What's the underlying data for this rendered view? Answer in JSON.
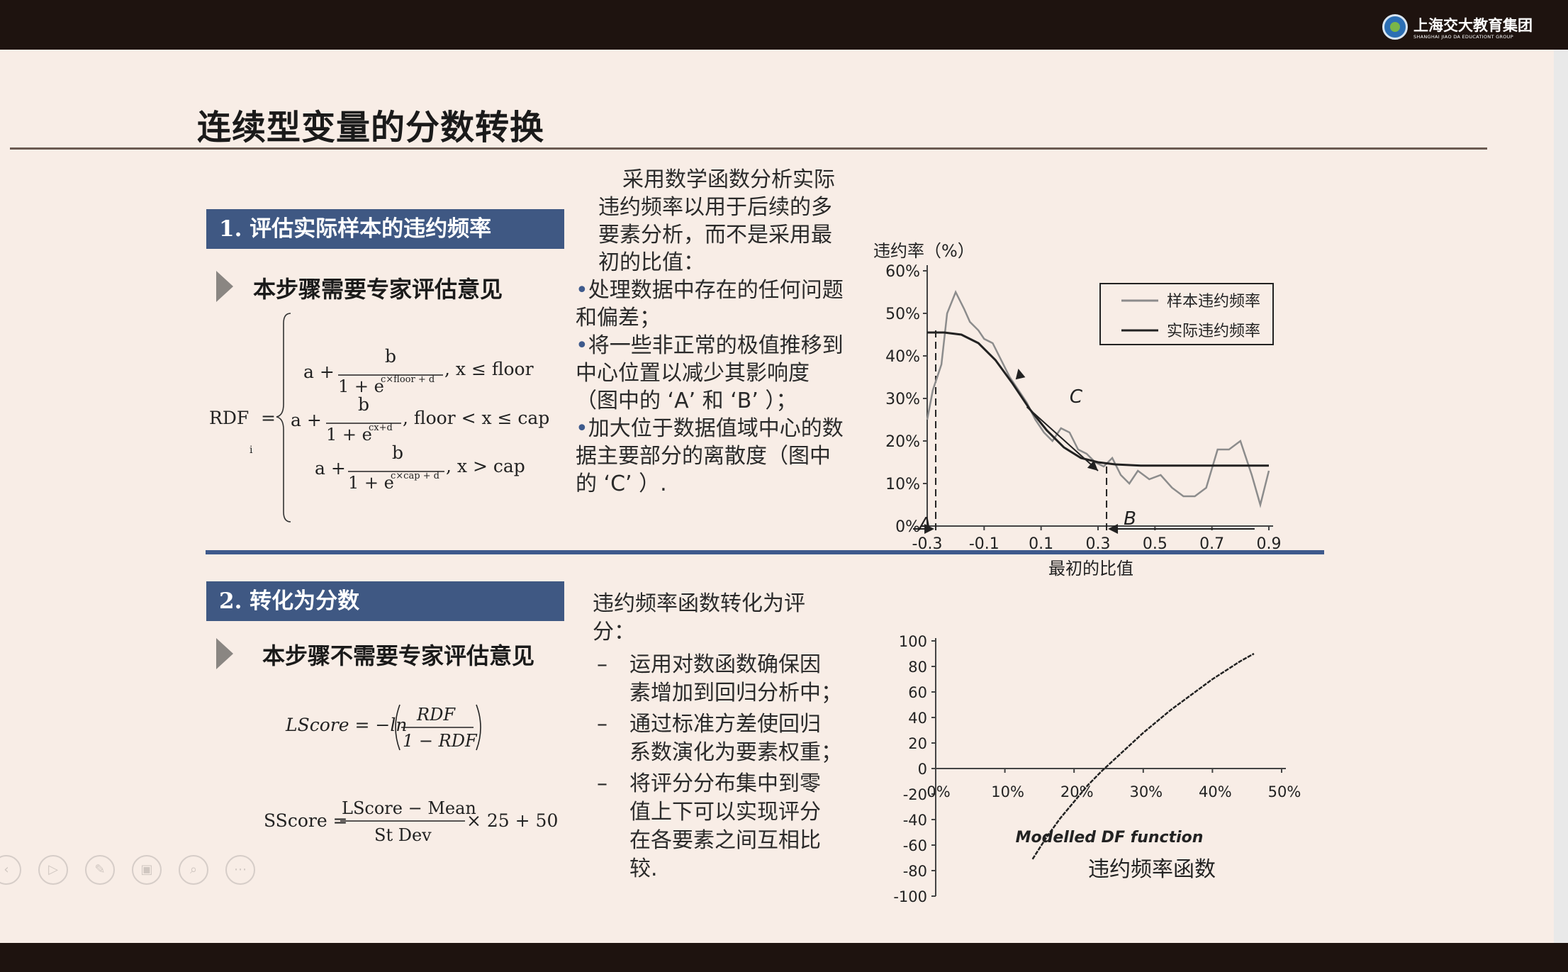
{
  "header": {
    "logo_text": "上海交大教育集团",
    "logo_subtext": "SHANGHAI JIAO DA EDUCATIONT GROUP"
  },
  "slide": {
    "title": "连续型变量的分数转换"
  },
  "step1": {
    "banner": "1.  评估实际样本的违约频率",
    "note": "本步骤需要专家评估意见",
    "text": {
      "intro_line1": "采用数学函数分析实际",
      "intro_line2": "违约频率以用于后续的多",
      "intro_line3": "要素分析，而不是采用最",
      "intro_line4": "初的比值：",
      "b1_line1": "处理数据中存在的任何问题",
      "b1_line2": "和偏差；",
      "b2_line1": "将一些非正常的极值推移到",
      "b2_line2": "中心位置以减少其影响度",
      "b2_line3": "（图中的 ‘A’  和  ‘B’  ）；",
      "b3_line1": "加大位于数据值域中心的数",
      "b3_line2": "据主要部分的离散度（图中",
      "b3_line3": "的 ‘C’  ）."
    },
    "formula": {
      "lhs": "RDF",
      "sub": "i",
      "eq": "=",
      "r1_a": "a +",
      "r1_num": "b",
      "r1_den": "1 + e",
      "r1_exp": "c×floor + d",
      "r1_cond": ", x ≤ floor",
      "r2_a": "a +",
      "r2_num": "b",
      "r2_den": "1 + e",
      "r2_exp": "cx+d",
      "r2_cond": ", floor  < x ≤ cap",
      "r3_a": "a +",
      "r3_num": "b",
      "r3_den": "1 + e",
      "r3_exp": "c×cap + d",
      "r3_cond": ", x > cap"
    }
  },
  "step2": {
    "banner": "2.  转化为分数",
    "note": "本步骤不需要专家评估意见",
    "text": {
      "intro_line1": "违约频率函数转化为评",
      "intro_line2": "分：",
      "d1_line1": "运用对数函数确保因",
      "d1_line2": "素增加到回归分析中；",
      "d2_line1": "通过标准方差使回归",
      "d2_line2": "系数演化为要素权重；",
      "d3_line1": "将评分分布集中到零",
      "d3_line2": "值上下可以实现评分",
      "d3_line3": "在各要素之间互相比",
      "d3_line4": "较.",
      "dash": "–"
    },
    "formula": {
      "lscore_lhs": "LScore = −ln",
      "lscore_num": "RDF",
      "lscore_den": "1 − RDF",
      "sscore_lhs": "SScore =",
      "sscore_num": "LScore − Mean",
      "sscore_den": "St Dev",
      "sscore_tail": "× 25 + 50"
    }
  },
  "chart_data": [
    {
      "type": "line",
      "ylabel": "违约率（%）",
      "xlabel": "最初的比值",
      "x_ticks": [
        "-0.3",
        "-0.1",
        "0.1",
        "0.3",
        "0.5",
        "0.7",
        "0.9"
      ],
      "y_ticks": [
        "0%",
        "10%",
        "20%",
        "30%",
        "40%",
        "50%",
        "60%"
      ],
      "xlim": [
        -0.3,
        0.9
      ],
      "ylim": [
        0,
        60
      ],
      "legend_position": "top-right",
      "annotations": {
        "A": "A",
        "B": "B",
        "C": "C"
      },
      "series": [
        {
          "name": "样本违约频率",
          "color": "#8c8c8c",
          "x": [
            -0.3,
            -0.28,
            -0.25,
            -0.23,
            -0.2,
            -0.17,
            -0.15,
            -0.12,
            -0.1,
            -0.07,
            -0.04,
            -0.01,
            0.02,
            0.05,
            0.08,
            0.11,
            0.14,
            0.17,
            0.2,
            0.23,
            0.26,
            0.29,
            0.32,
            0.35,
            0.38,
            0.41,
            0.44,
            0.48,
            0.52,
            0.56,
            0.6,
            0.64,
            0.68,
            0.72,
            0.76,
            0.8,
            0.84,
            0.87,
            0.9
          ],
          "y": [
            25,
            32,
            38,
            50,
            55,
            51,
            48,
            46,
            44,
            43,
            39,
            35,
            32,
            29,
            25,
            22,
            20,
            23,
            22,
            18,
            17,
            15,
            14,
            16,
            12,
            10,
            13,
            11,
            12,
            9,
            7,
            7,
            9,
            18,
            18,
            20,
            12,
            5,
            13
          ]
        },
        {
          "name": "实际违约频率",
          "color": "#222222",
          "x": [
            -0.3,
            -0.24,
            -0.18,
            -0.12,
            -0.06,
            0.0,
            0.06,
            0.12,
            0.18,
            0.24,
            0.3,
            0.36,
            0.45,
            0.6,
            0.75,
            0.9
          ],
          "y": [
            45.5,
            45.5,
            45,
            43,
            39,
            33.5,
            27.5,
            22.5,
            18.5,
            16,
            15,
            14.5,
            14.2,
            14.2,
            14.2,
            14.2
          ]
        }
      ]
    },
    {
      "type": "line",
      "title": "Modelled DF function",
      "caption": "违约频率函数",
      "x_ticks": [
        "0%",
        "10%",
        "20%",
        "30%",
        "40%",
        "50%"
      ],
      "y_ticks": [
        "100",
        "80",
        "60",
        "40",
        "20",
        "0",
        "-20",
        "-40",
        "-60",
        "-80",
        "-100"
      ],
      "xlim": [
        0,
        0.5
      ],
      "ylim": [
        -100,
        100
      ],
      "series": [
        {
          "x": [
            0.14,
            0.16,
            0.18,
            0.2,
            0.22,
            0.24,
            0.26,
            0.28,
            0.3,
            0.32,
            0.34,
            0.36,
            0.38,
            0.4,
            0.42,
            0.44,
            0.46
          ],
          "y": [
            -71,
            -54,
            -39,
            -26,
            -13,
            -2,
            8,
            18,
            28,
            37,
            46,
            54,
            62,
            70,
            77,
            84,
            90
          ]
        }
      ]
    }
  ],
  "presenter_toolbar": {
    "buttons": [
      "‹",
      "▷",
      "✎",
      "▣",
      "⌕",
      "⋯"
    ]
  }
}
